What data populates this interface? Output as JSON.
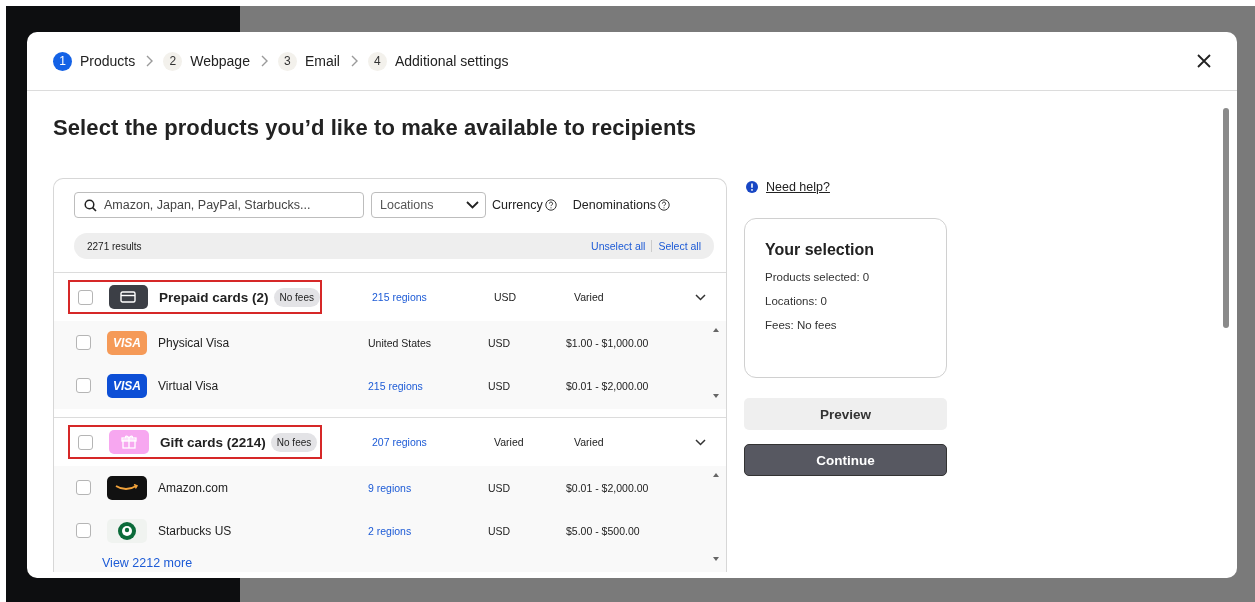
{
  "steps": [
    {
      "number": "1",
      "label": "Products",
      "selected": true
    },
    {
      "number": "2",
      "label": "Webpage",
      "selected": false
    },
    {
      "number": "3",
      "label": "Email",
      "selected": false
    },
    {
      "number": "4",
      "label": "Additional settings",
      "selected": false
    }
  ],
  "heading": "Select the products you’d like to make available to recipients",
  "filters": {
    "search": {
      "placeholder": "Amazon, Japan, PayPal, Starbucks..."
    },
    "locations": {
      "placeholder": "Locations"
    },
    "currency": "Currency",
    "denominations": "Denominations"
  },
  "results": {
    "count": "2271 results",
    "unselect_all": "Unselect all",
    "select_all": "Select all"
  },
  "groups": [
    {
      "title": "Prepaid cards (2)",
      "badge": "No fees",
      "kind": "card",
      "highlighted": true,
      "checked": false,
      "expanded": true,
      "regions": "215 regions",
      "currency": "USD",
      "denominations": "Varied",
      "items": [
        {
          "name": "Physical Visa",
          "logo_text": "VISA",
          "checked": false,
          "location": {
            "kind": "text",
            "text": "United States"
          },
          "currency": "USD",
          "denominations": "$1.00 - $1,000.00"
        },
        {
          "name": "Virtual Visa",
          "logo_text": "VISA",
          "checked": false,
          "location": {
            "kind": "link",
            "text": "215 regions"
          },
          "currency": "USD",
          "denominations": "$0.01 - $2,000.00"
        }
      ]
    },
    {
      "title": "Gift cards (2214)",
      "badge": "No fees",
      "kind": "gift",
      "highlighted": true,
      "checked": false,
      "expanded": true,
      "regions": "207 regions",
      "currency": "Varied",
      "denominations": "Varied",
      "items": [
        {
          "name": "Amazon.com",
          "checked": false,
          "location": {
            "kind": "link",
            "text": "9 regions"
          },
          "currency": "USD",
          "denominations": "$0.01 - $2,000.00"
        },
        {
          "name": "Starbucks US",
          "checked": false,
          "location": {
            "kind": "link",
            "text": "2 regions"
          },
          "currency": "USD",
          "denominations": "$5.00 - $500.00"
        }
      ],
      "view_more": "View 2212 more"
    }
  ],
  "help": "Need help?",
  "selection": {
    "title": "Your selection",
    "lines": [
      "Products selected: 0",
      "Locations: 0",
      "Fees: No fees"
    ]
  },
  "buttons": [
    {
      "label": "Preview",
      "kind": "secondary"
    },
    {
      "label": "Continue",
      "kind": "primary"
    }
  ]
}
